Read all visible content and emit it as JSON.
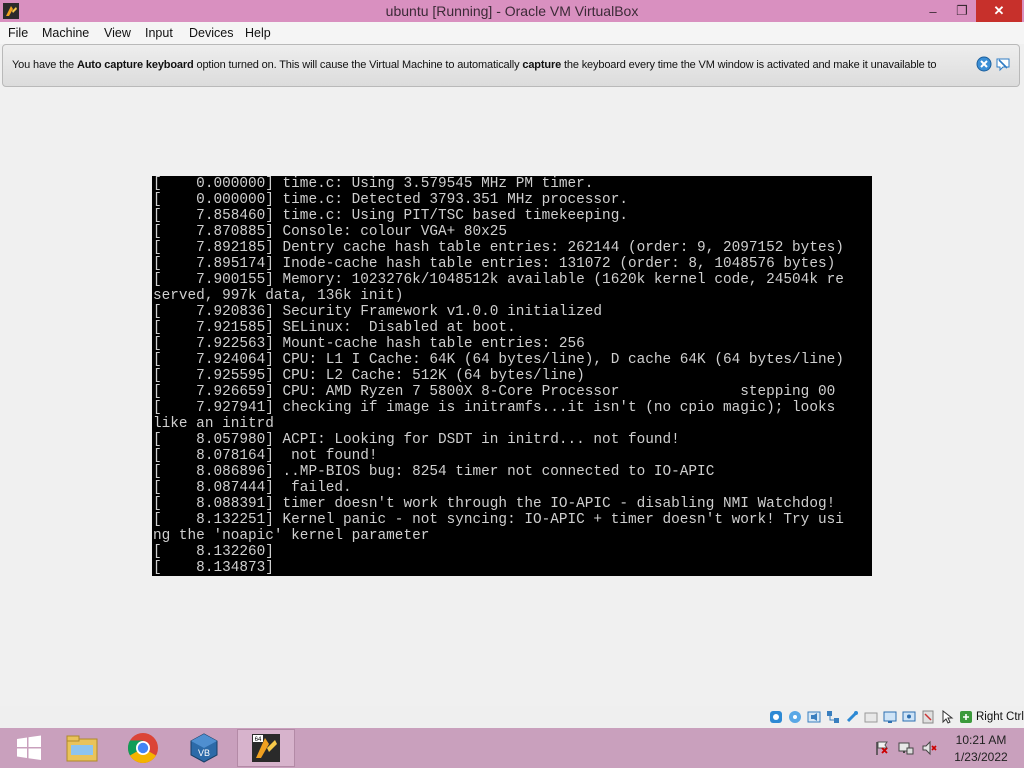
{
  "window": {
    "title": "ubuntu [Running] - Oracle VM VirtualBox",
    "app_icon": "virtualbox-icon",
    "controls": {
      "minimize": "–",
      "maximize": "❐",
      "close": "✕"
    }
  },
  "menu": [
    "File",
    "Machine",
    "View",
    "Input",
    "Devices",
    "Help"
  ],
  "banner": {
    "segments": [
      {
        "text": "You have the ",
        "bold": false
      },
      {
        "text": "Auto capture keyboard",
        "bold": true
      },
      {
        "text": " option turned on. This will cause the Virtual Machine to automatically ",
        "bold": false
      },
      {
        "text": "capture",
        "bold": true
      },
      {
        "text": " the keyboard every time the VM window is activated and make it unavailable to",
        "bold": false
      }
    ],
    "icons": [
      "close-banner-icon",
      "do-not-show-again-icon"
    ]
  },
  "console_lines": [
    "[    0.000000] time.c: Using 3.579545 MHz PM timer.",
    "[    0.000000] time.c: Detected 3793.351 MHz processor.",
    "[    7.858460] time.c: Using PIT/TSC based timekeeping.",
    "[    7.870885] Console: colour VGA+ 80x25",
    "[    7.892185] Dentry cache hash table entries: 262144 (order: 9, 2097152 bytes)",
    "[    7.895174] Inode-cache hash table entries: 131072 (order: 8, 1048576 bytes)",
    "[    7.900155] Memory: 1023276k/1048512k available (1620k kernel code, 24504k re",
    "served, 997k data, 136k init)",
    "[    7.920836] Security Framework v1.0.0 initialized",
    "[    7.921585] SELinux:  Disabled at boot.",
    "[    7.922563] Mount-cache hash table entries: 256",
    "[    7.924064] CPU: L1 I Cache: 64K (64 bytes/line), D cache 64K (64 bytes/line)",
    "[    7.925595] CPU: L2 Cache: 512K (64 bytes/line)",
    "[    7.926659] CPU: AMD Ryzen 7 5800X 8-Core Processor              stepping 00",
    "[    7.927941] checking if image is initramfs...it isn't (no cpio magic); looks",
    "like an initrd",
    "[    8.057980] ACPI: Looking for DSDT in initrd... not found!",
    "[    8.078164]  not found!",
    "[    8.086896] ..MP-BIOS bug: 8254 timer not connected to IO-APIC",
    "[    8.087444]  failed.",
    "[    8.088391] timer doesn't work through the IO-APIC - disabling NMI Watchdog!",
    "[    8.132251] Kernel panic - not syncing: IO-APIC + timer doesn't work! Try usi",
    "ng the 'noapic' kernel parameter",
    "[    8.132260]",
    "[    8.134873]"
  ],
  "statusbar": {
    "icons": [
      "hard-disk-icon",
      "optical-drive-icon",
      "audio-icon",
      "network-icon",
      "usb-icon",
      "shared-folders-icon",
      "display-icon",
      "video-capture-icon",
      "cpu-icon",
      "mouse-integration-icon",
      "keyboard-capture-icon"
    ],
    "host_key": "Right Ctrl"
  },
  "taskbar": {
    "apps": [
      {
        "name": "start-button",
        "active": false
      },
      {
        "name": "file-explorer-icon",
        "active": false
      },
      {
        "name": "chrome-icon",
        "active": false
      },
      {
        "name": "virtualbox-manager-icon",
        "active": false
      },
      {
        "name": "virtualbox-vm-icon",
        "active": true
      }
    ],
    "tray_icons": [
      "action-center-flag-icon",
      "network-tray-icon",
      "volume-muted-icon"
    ],
    "time": "10:21 AM",
    "date": "1/23/2022"
  }
}
